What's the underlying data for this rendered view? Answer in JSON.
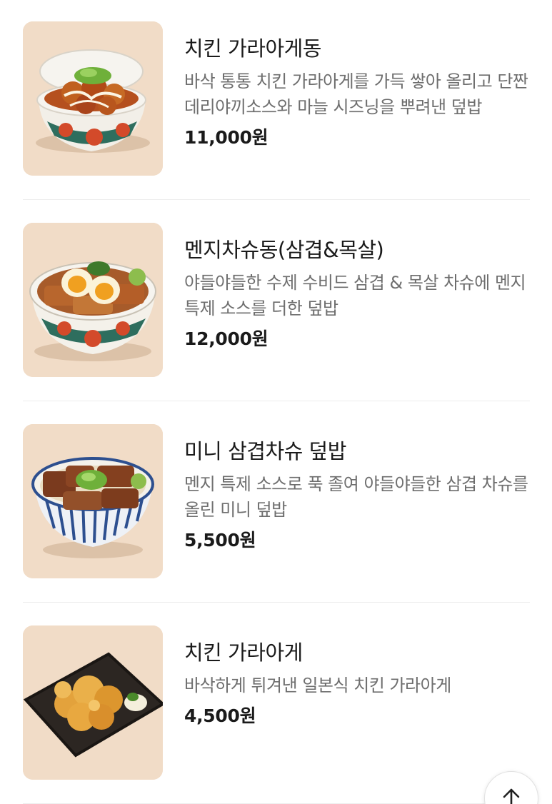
{
  "menu": {
    "items": [
      {
        "name": "치킨 가라아게동",
        "description": "바삭 통통 치킨 가라아게를 가득 쌓아 올리고 단짠 데리야끼소스와 마늘 시즈닝을 뿌려낸 덮밥",
        "price": "11,000원",
        "image_icon": "chicken-karaage-bowl-photo"
      },
      {
        "name": "멘지차슈동(삼겹&목살)",
        "description": "야들야들한 수제 수비드 삼겹 & 목살 차슈에 멘지 특제 소스를 더한 덮밥",
        "price": "12,000원",
        "image_icon": "chashu-bowl-photo"
      },
      {
        "name": "미니 삼겹차슈 덮밥",
        "description": "멘지 특제 소스로 푹 졸여 야들야들한 삼겹 차슈를 올린 미니 덮밥",
        "price": "5,500원",
        "image_icon": "mini-chashu-bowl-photo"
      },
      {
        "name": "치킨 가라아게",
        "description": "바삭하게 튀겨낸 일본식 치킨 가라아게",
        "price": "4,500원",
        "image_icon": "karaage-plate-photo"
      }
    ]
  },
  "scroll_top_icon": "arrow-up-icon",
  "colors": {
    "thumb_background": "#f1dcc7",
    "price_text": "#1a1a1a",
    "description_text": "#6e6e6e"
  }
}
